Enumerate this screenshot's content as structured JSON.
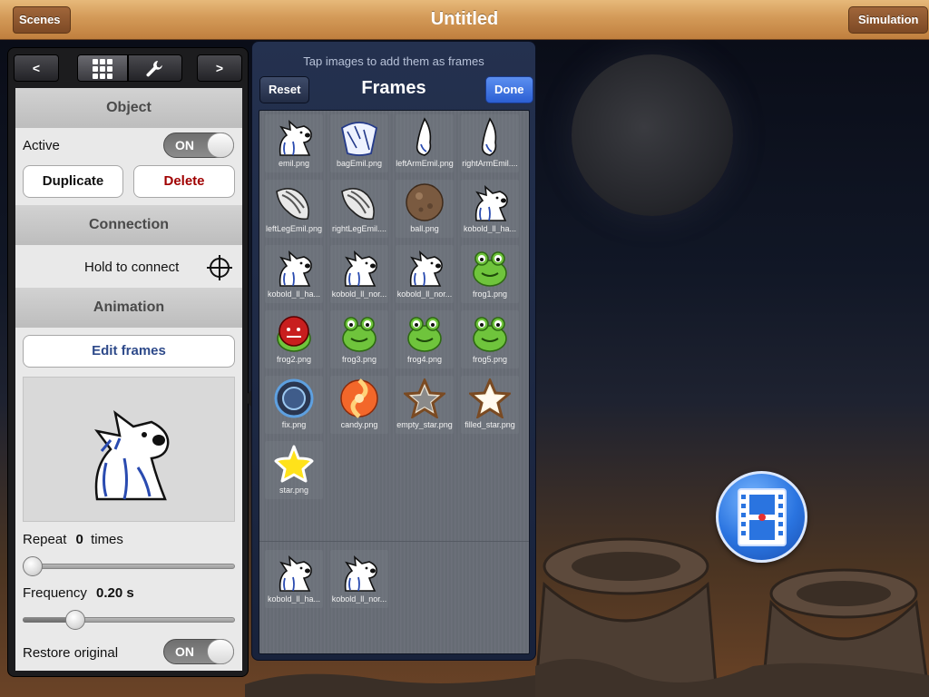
{
  "topbar": {
    "title": "Untitled",
    "scenes_label": "Scenes",
    "simulation_label": "Simulation"
  },
  "inspector": {
    "segments": {
      "prev": "<",
      "next": ">",
      "grid_icon": "grid-icon",
      "tools_icon": "wrench-icon"
    },
    "object": {
      "header": "Object",
      "active_label": "Active",
      "active_toggle": "ON",
      "duplicate_label": "Duplicate",
      "delete_label": "Delete"
    },
    "connection": {
      "header": "Connection",
      "hold_label": "Hold to connect"
    },
    "animation": {
      "header": "Animation",
      "edit_frames_label": "Edit frames",
      "repeat_label": "Repeat",
      "repeat_value": "0",
      "repeat_unit": "times",
      "repeat_slider_fraction": 0.0,
      "frequency_label": "Frequency",
      "frequency_value": "0.20 s",
      "frequency_slider_fraction": 0.22,
      "restore_label": "Restore original",
      "restore_toggle": "ON"
    }
  },
  "frames_panel": {
    "hint": "Tap images to add them as frames",
    "title": "Frames",
    "reset_label": "Reset",
    "done_label": "Done",
    "images": [
      {
        "caption": "emil.png",
        "icon": "kobold-icon"
      },
      {
        "caption": "bagEmil.png",
        "icon": "bag-icon"
      },
      {
        "caption": "leftArmEmil.png",
        "icon": "arm-icon"
      },
      {
        "caption": "rightArmEmil....",
        "icon": "arm-icon"
      },
      {
        "caption": "leftLegEmil.png",
        "icon": "leg-icon"
      },
      {
        "caption": "rightLegEmil....",
        "icon": "leg-icon"
      },
      {
        "caption": "ball.png",
        "icon": "ball-icon"
      },
      {
        "caption": "kobold_ll_ha...",
        "icon": "kobold-icon"
      },
      {
        "caption": "kobold_ll_ha...",
        "icon": "kobold-icon"
      },
      {
        "caption": "kobold_ll_nor...",
        "icon": "kobold-icon"
      },
      {
        "caption": "kobold_ll_nor...",
        "icon": "kobold-icon"
      },
      {
        "caption": "frog1.png",
        "icon": "frog-icon"
      },
      {
        "caption": "frog2.png",
        "icon": "frog-red-mouth-icon"
      },
      {
        "caption": "frog3.png",
        "icon": "frog-icon"
      },
      {
        "caption": "frog4.png",
        "icon": "frog-icon"
      },
      {
        "caption": "frog5.png",
        "icon": "frog-icon"
      },
      {
        "caption": "fix.png",
        "icon": "fix-ring-icon"
      },
      {
        "caption": "candy.png",
        "icon": "candy-icon"
      },
      {
        "caption": "empty_star.png",
        "icon": "empty-star-icon"
      },
      {
        "caption": "filled_star.png",
        "icon": "filled-star-icon"
      },
      {
        "caption": "star.png",
        "icon": "yellow-star-icon"
      }
    ],
    "selected_frames": [
      {
        "caption": "kobold_ll_ha...",
        "icon": "kobold-icon"
      },
      {
        "caption": "kobold_ll_nor...",
        "icon": "kobold-icon"
      }
    ]
  },
  "colors": {
    "wood_top": "#d39a58",
    "done_blue": "#2b5fd4",
    "delete_red": "#a00000",
    "edit_frames_blue": "#2e4a8a",
    "film_button_blue": "#2a74e0"
  }
}
